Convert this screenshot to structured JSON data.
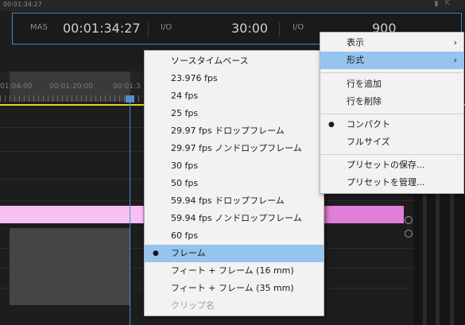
{
  "top": {
    "time": "00:01:34:27"
  },
  "timecode": {
    "mas_label": "MAS",
    "current": "00:01:34:27",
    "io_label_1": "I/O",
    "duration": "30:00",
    "io_label_2": "I/O",
    "frames": "900"
  },
  "ruler": {
    "labels": [
      "01:04:00",
      "00:01:20:00",
      "00:01:3"
    ]
  },
  "context_menu": {
    "items": [
      {
        "label": "表示",
        "has_submenu": true
      },
      {
        "label": "形式",
        "has_submenu": true,
        "highlighted": true
      },
      {
        "label": "行を追加"
      },
      {
        "label": "行を削除"
      },
      {
        "label": "コンパクト",
        "checked": true
      },
      {
        "label": "フルサイズ"
      },
      {
        "label": "プリセットの保存..."
      },
      {
        "label": "プリセットを管理..."
      }
    ],
    "submenu_arrow": "›"
  },
  "format_submenu": {
    "items": [
      "ソースタイムベース",
      "23.976 fps",
      "24 fps",
      "25 fps",
      "29.97 fps ドロップフレーム",
      "29.97 fps ノンドロップフレーム",
      "30 fps",
      "50 fps",
      "59.94 fps ドロップフレーム",
      "59.94 fps ノンドロップフレーム",
      "60 fps",
      "フレーム",
      "フィート + フレーム (16 mm)",
      "フィート + フレーム (35 mm)",
      "クリップ名"
    ],
    "selected": "フレーム",
    "disabled": "クリップ名"
  },
  "colors": {
    "menu_highlight": "#95c4ee",
    "panel_border": "#3d87c9",
    "playhead": "#4f8fd1",
    "work_area": "#e6d22a",
    "clip_pink": "#e07fd8"
  }
}
